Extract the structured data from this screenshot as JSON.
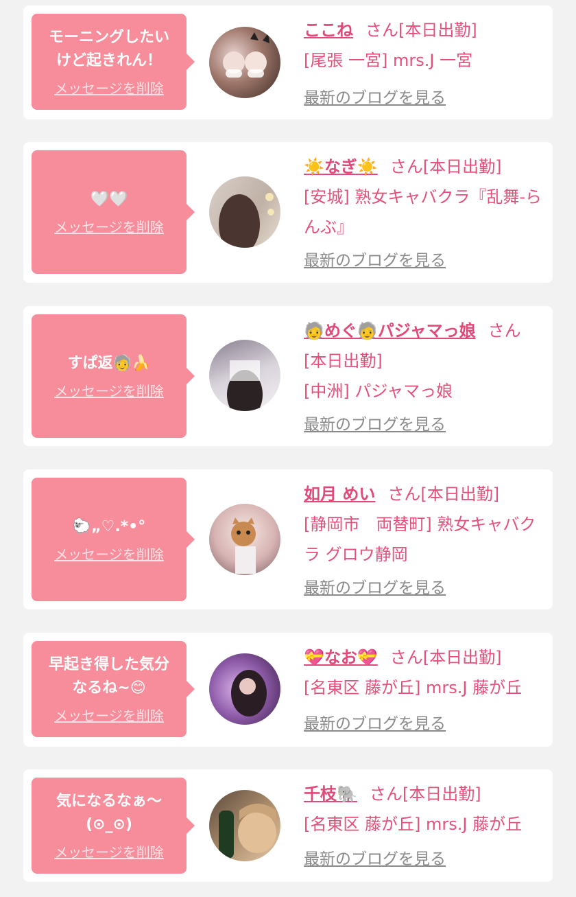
{
  "colors": {
    "accent": "#f78c9a",
    "name": "#e14a78",
    "shop": "#e4507a",
    "link": "#8a8a8a",
    "background": "#f2f2f2"
  },
  "cards": [
    {
      "message": "モーニングしたい\nけど起きれん！",
      "delete_label": "メッセージを削除",
      "name": "ここね",
      "suffix": "さん[本日出勤]",
      "shop": "[尾張 一宮] mrs.J 一宮",
      "blog_label": "最新のブログを見る",
      "avatar_desc": "avatar-photo"
    },
    {
      "message": "🤍🤍",
      "delete_label": "メッセージを削除",
      "name": "☀️なぎ☀️",
      "suffix": "さん[本日出勤]",
      "shop": "[安城] 熟女キャバクラ『乱舞-らんぶ』",
      "blog_label": "最新のブログを見る",
      "avatar_desc": "avatar-photo"
    },
    {
      "message": "すぱ返🧓🍌",
      "delete_label": "メッセージを削除",
      "name": "🧓めぐ🧓パジャマっ娘",
      "suffix": "さん[本日出勤]",
      "shop": "[中洲] パジャマっ娘",
      "blog_label": "最新のブログを見る",
      "avatar_desc": "avatar-photo"
    },
    {
      "message": "🐑„♡.*•°",
      "delete_label": "メッセージを削除",
      "name": "如月 めい",
      "suffix": "さん[本日出勤]",
      "shop": "[静岡市　両替町] 熟女キャバクラ グロウ静岡",
      "blog_label": "最新のブログを見る",
      "avatar_desc": "avatar-photo"
    },
    {
      "message": "早起き得した気分\nなるね~😊",
      "delete_label": "メッセージを削除",
      "name": "💝なお💝",
      "suffix": "さん[本日出勤]",
      "shop": "[名東区 藤が丘] mrs.J 藤が丘",
      "blog_label": "最新のブログを見る",
      "avatar_desc": "avatar-photo"
    },
    {
      "message": "気になるなぁ〜\n(⊙_⊙)",
      "delete_label": "メッセージを削除",
      "name": "千枝🐘",
      "suffix": "さん[本日出勤]",
      "shop": "[名東区 藤が丘] mrs.J 藤が丘",
      "blog_label": "最新のブログを見る",
      "avatar_desc": "avatar-photo"
    }
  ]
}
